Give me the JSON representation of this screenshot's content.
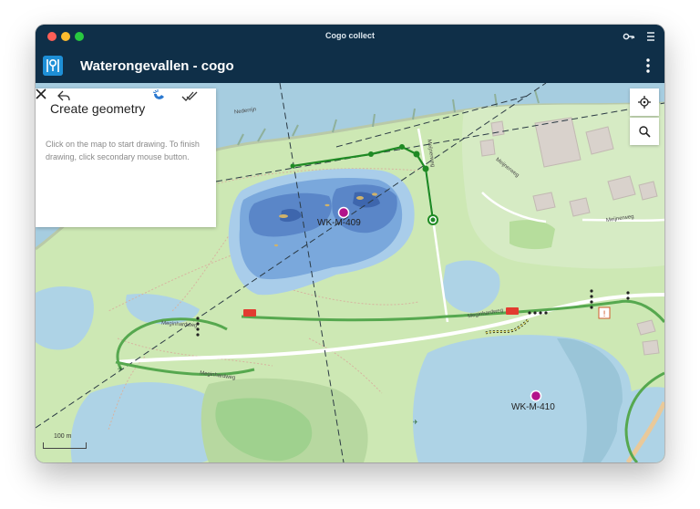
{
  "window": {
    "title": "Cogo collect"
  },
  "app": {
    "title": "Waterongevallen - cogo"
  },
  "panel": {
    "title": "Create geometry",
    "help": "Click on the map to start drawing. To finish drawing, click secondary mouse button."
  },
  "map": {
    "points": [
      {
        "label": "WK-M-409",
        "color": "#b3138a"
      },
      {
        "label": "WK-M-410",
        "color": "#b3138a"
      }
    ],
    "streets": [
      "Meginhardweg",
      "Meginhardweg",
      "Meginhardweg",
      "Meijnerweg",
      "Meijnerweg",
      "Meijnerweg",
      "Nederrijn"
    ],
    "scale": "100 m",
    "colors": {
      "land": "#cde8b4",
      "water": "#aed3e6",
      "river": "#a6cde0",
      "route": "#3f9a3c",
      "drawing": "#1f8a24"
    }
  }
}
